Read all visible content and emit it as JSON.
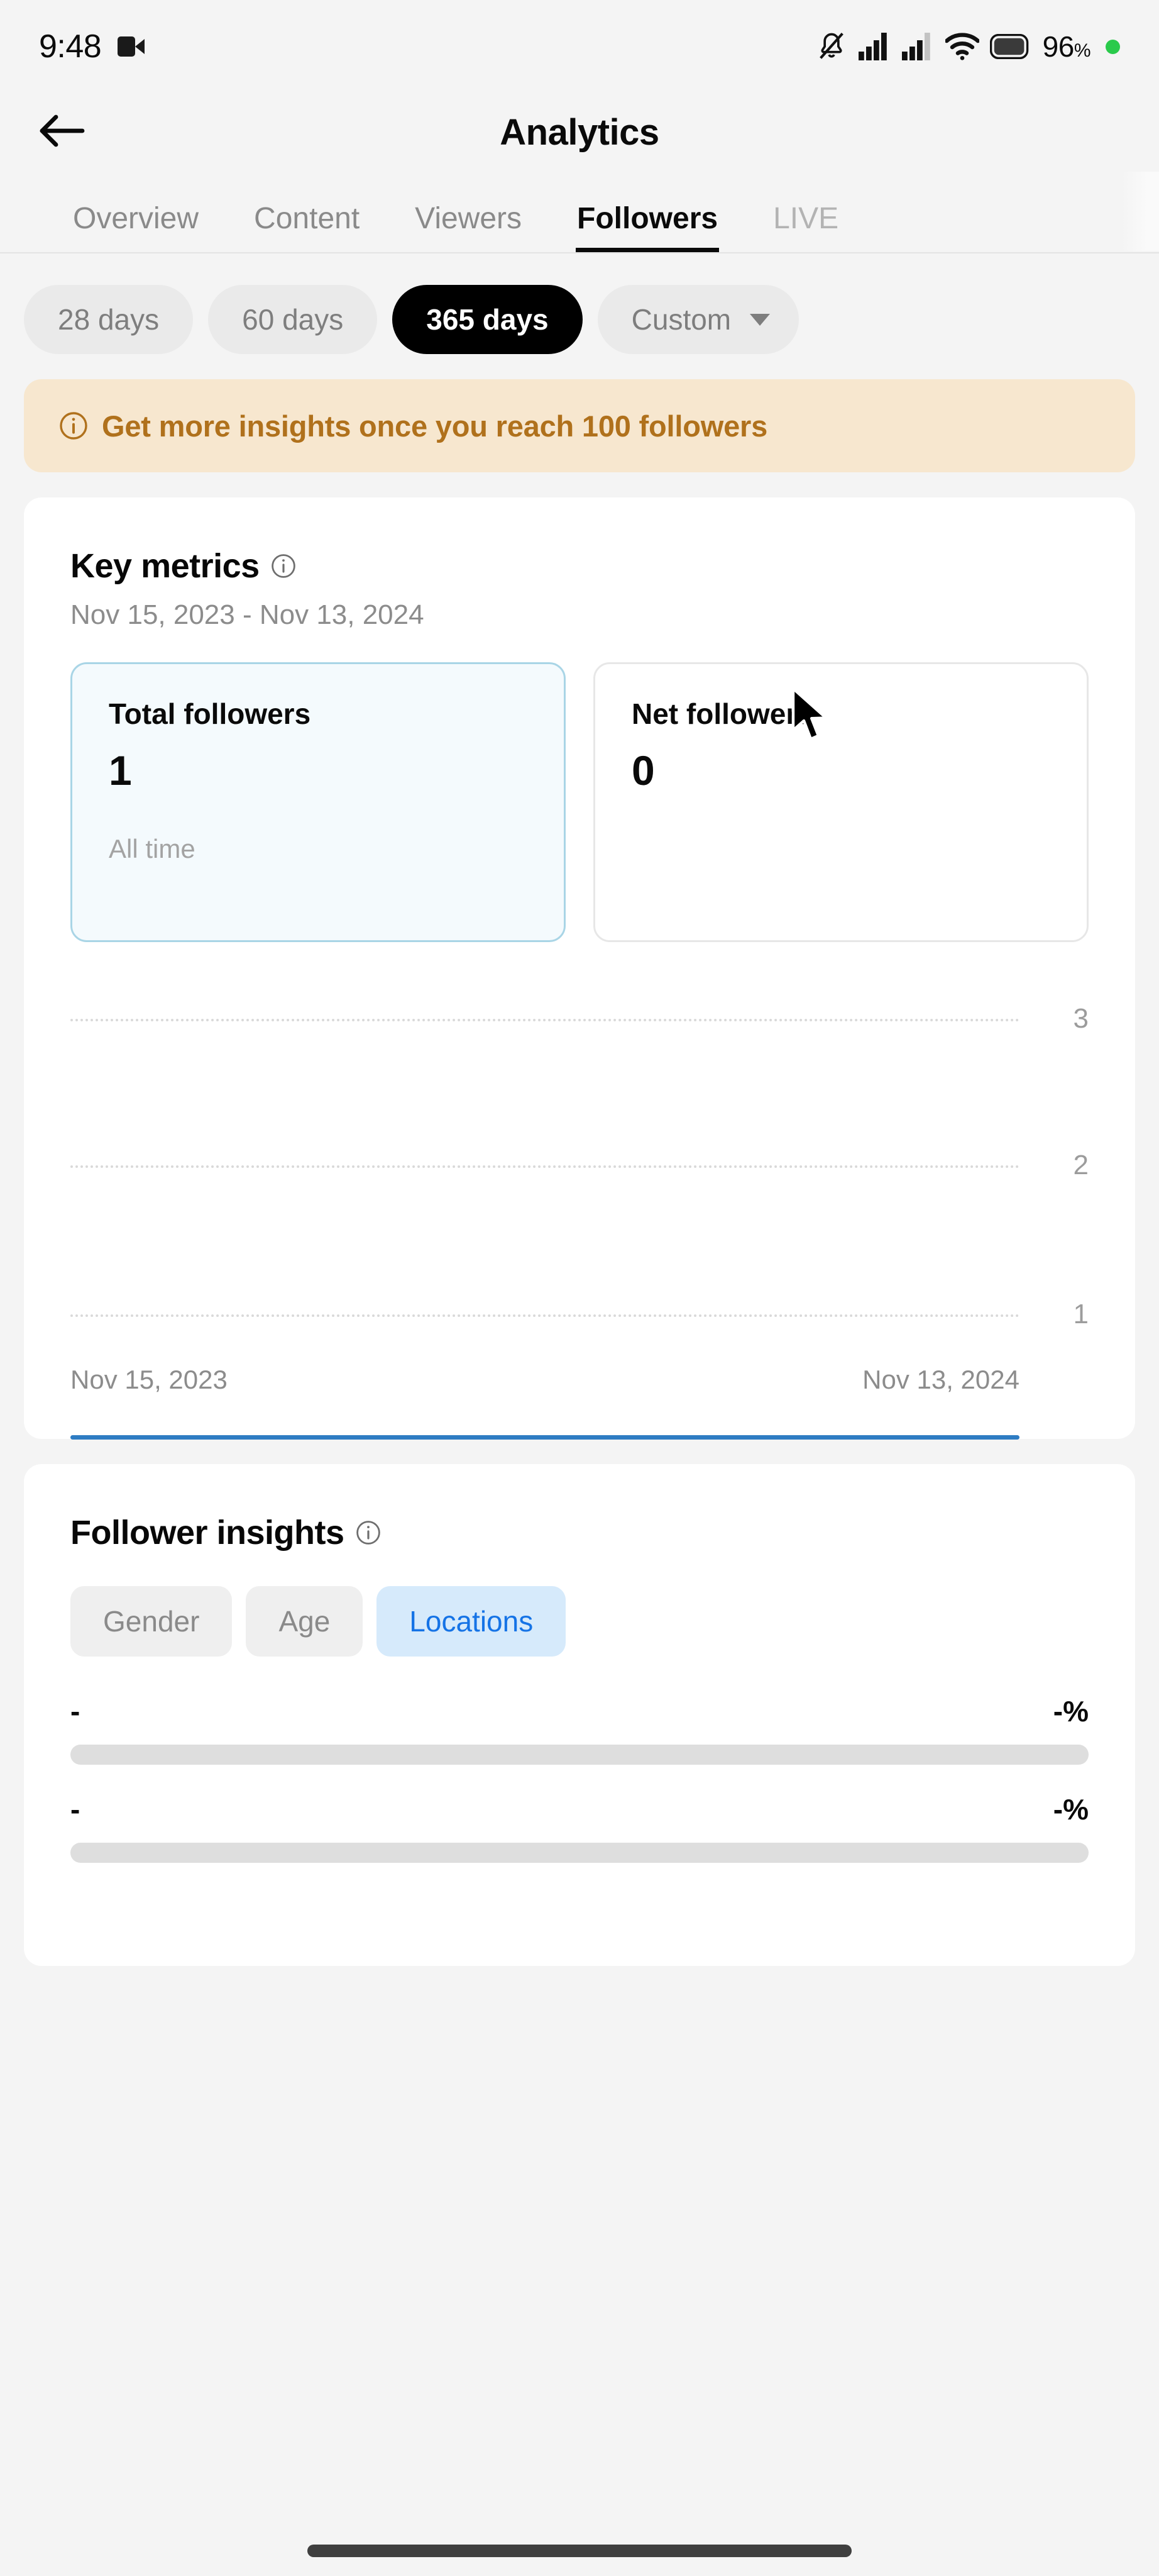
{
  "status_bar": {
    "time": "9:48",
    "camera_icon": "video-camera-icon",
    "mute_icon": "bell-muted-icon",
    "signal1_icon": "cellular-signal-icon",
    "signal2_icon": "cellular-signal-icon",
    "wifi_icon": "wifi-icon",
    "battery_icon": "battery-icon",
    "battery_percent": "96",
    "percent_sign": "%",
    "recording_dot": "green-status-dot"
  },
  "header": {
    "back_icon": "back-arrow-icon",
    "title": "Analytics"
  },
  "tabs": [
    {
      "label": "Overview",
      "active": false
    },
    {
      "label": "Content",
      "active": false
    },
    {
      "label": "Viewers",
      "active": false
    },
    {
      "label": "Followers",
      "active": true
    },
    {
      "label": "LIVE",
      "active": false
    }
  ],
  "date_range_chips": [
    {
      "label": "28 days",
      "active": false
    },
    {
      "label": "60 days",
      "active": false
    },
    {
      "label": "365 days",
      "active": true
    },
    {
      "label": "Custom",
      "active": false,
      "has_caret": true
    }
  ],
  "banner": {
    "icon": "info-circle-icon",
    "text": "Get more insights once you reach 100 followers",
    "bg_color": "#F7E7CF",
    "text_color": "#B0711C"
  },
  "key_metrics": {
    "title": "Key metrics",
    "info_icon": "info-circle-icon",
    "date_range": "Nov 15, 2023 - Nov 13, 2024",
    "tiles": [
      {
        "label": "Total followers",
        "value": "1",
        "note": "All time",
        "selected": true
      },
      {
        "label": "Net followers",
        "value": "0",
        "note": "",
        "selected": false
      }
    ],
    "axis_start": "Nov 15, 2023",
    "axis_end": "Nov 13, 2024"
  },
  "chart_data": {
    "type": "line",
    "title": "Total followers",
    "xlabel": "",
    "ylabel": "",
    "x": [
      "Nov 15, 2023",
      "Nov 13, 2024"
    ],
    "tick_labels_y": [
      "1",
      "2",
      "3"
    ],
    "ylim": [
      0,
      3.6
    ],
    "grid": true,
    "legend": "none",
    "line_color": "#2E7CC3",
    "series": [
      {
        "name": "Total followers",
        "values": [
          0,
          0
        ]
      }
    ]
  },
  "follower_insights": {
    "title": "Follower insights",
    "info_icon": "info-circle-icon",
    "toggles": [
      {
        "label": "Gender",
        "active": false
      },
      {
        "label": "Age",
        "active": false
      },
      {
        "label": "Locations",
        "active": true
      }
    ],
    "rows": [
      {
        "name": "-",
        "percent": "-%",
        "fill": 0
      },
      {
        "name": "-",
        "percent": "-%",
        "fill": 0
      }
    ]
  },
  "system": {
    "home_indicator": "home-indicator-bar",
    "cursor": "mouse-pointer"
  }
}
